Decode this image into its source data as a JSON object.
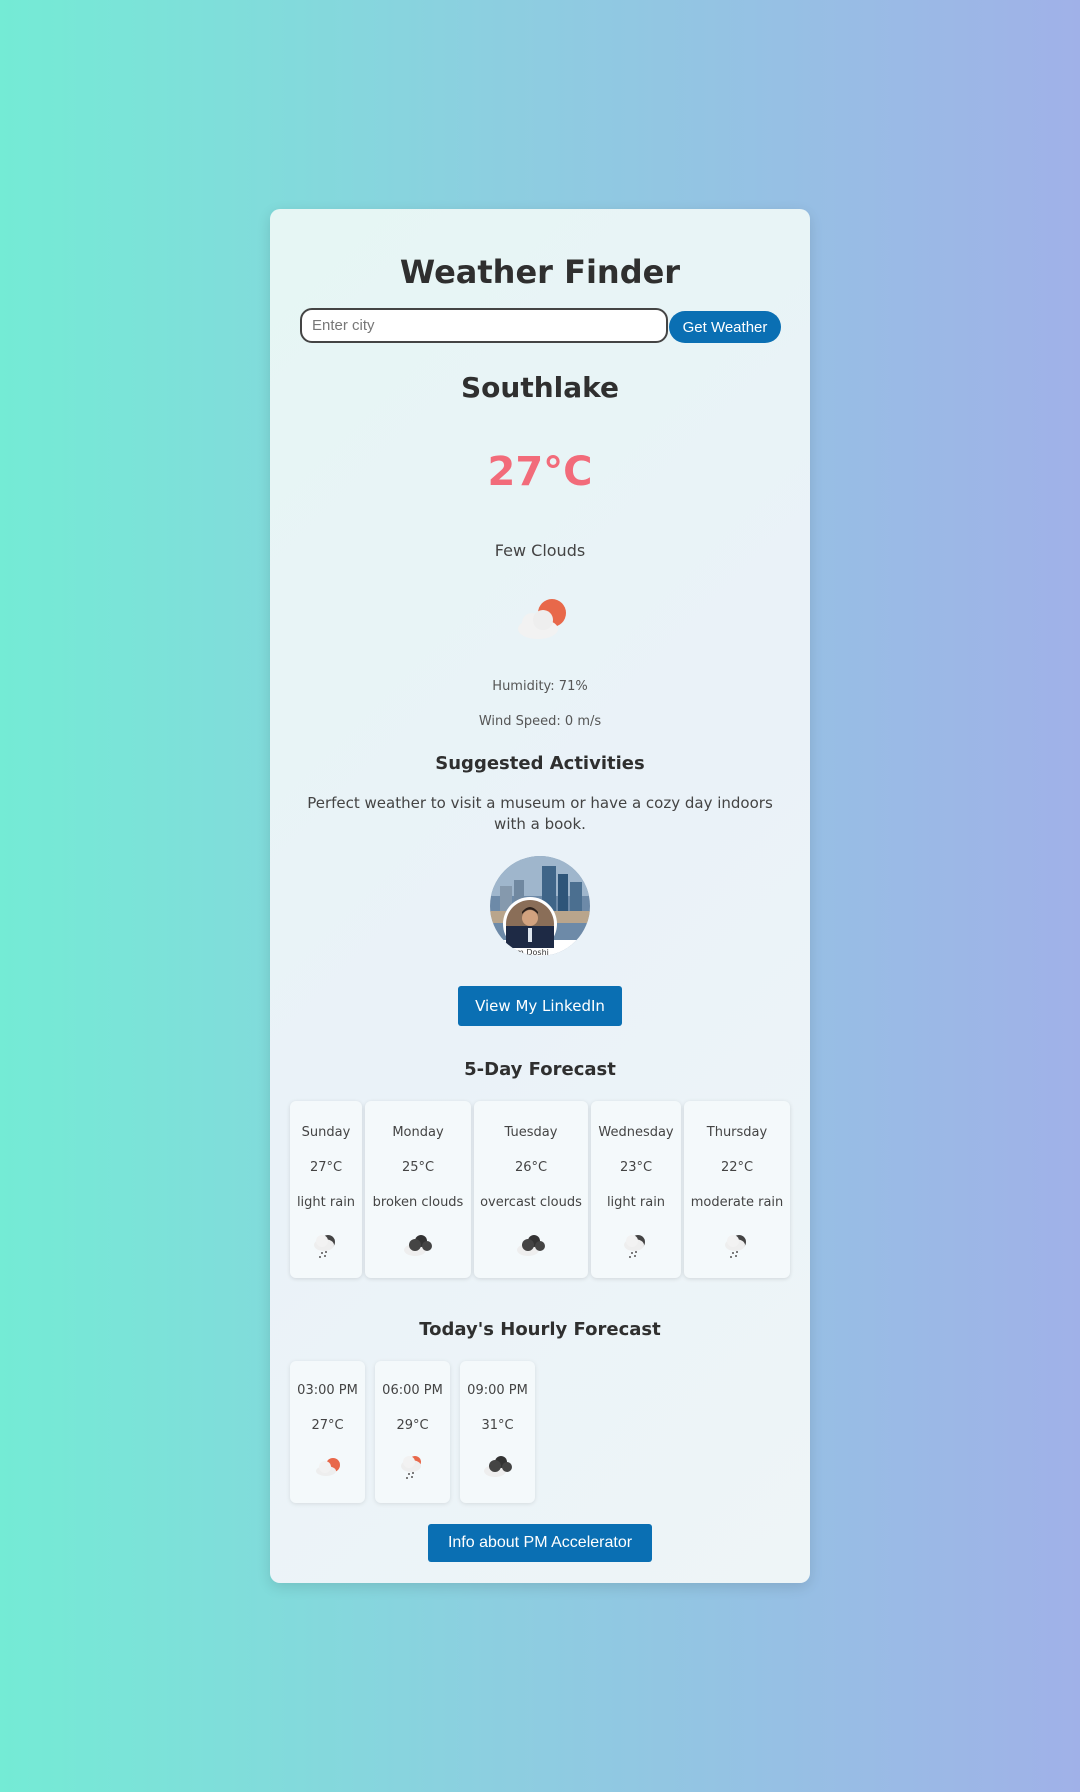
{
  "app": {
    "title": "Weather Finder"
  },
  "search": {
    "placeholder": "Enter city",
    "value": "",
    "button_label": "Get Weather"
  },
  "current": {
    "city": "Southlake",
    "temperature": "27°C",
    "description": "Few Clouds",
    "icon": "few-clouds-day-icon",
    "humidity": "Humidity: 71%",
    "wind": "Wind Speed: 0 m/s"
  },
  "activities": {
    "title": "Suggested Activities",
    "text": "Perfect weather to visit a museum or have a cozy day indoors with a book."
  },
  "profile": {
    "photo_caption": "am Doshi",
    "linkedin_label": "View My LinkedIn"
  },
  "forecast": {
    "title": "5-Day Forecast",
    "days": [
      {
        "day": "Sunday",
        "temp": "27°C",
        "desc": "light rain",
        "icon": "rain-icon"
      },
      {
        "day": "Monday",
        "temp": "25°C",
        "desc": "broken clouds",
        "icon": "broken-clouds-icon"
      },
      {
        "day": "Tuesday",
        "temp": "26°C",
        "desc": "overcast clouds",
        "icon": "broken-clouds-icon"
      },
      {
        "day": "Wednesday",
        "temp": "23°C",
        "desc": "light rain",
        "icon": "rain-icon"
      },
      {
        "day": "Thursday",
        "temp": "22°C",
        "desc": "moderate rain",
        "icon": "rain-icon"
      }
    ]
  },
  "hourly": {
    "title": "Today's Hourly Forecast",
    "hours": [
      {
        "time": "03:00 PM",
        "temp": "27°C",
        "icon": "few-clouds-day-icon"
      },
      {
        "time": "06:00 PM",
        "temp": "29°C",
        "icon": "rain-day-icon"
      },
      {
        "time": "09:00 PM",
        "temp": "31°C",
        "icon": "broken-clouds-icon"
      }
    ]
  },
  "footer": {
    "pm_button_label": "Info about PM Accelerator"
  },
  "colors": {
    "accent": "#0a6fb3",
    "temperature": "#f26b7a",
    "sun": "#e8684a"
  }
}
